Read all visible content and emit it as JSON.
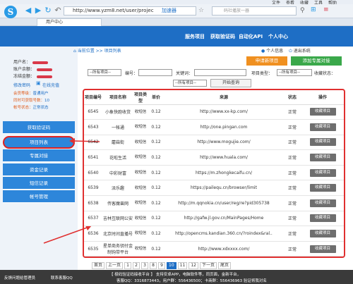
{
  "browser": {
    "menu": [
      "文件",
      "查看",
      "收藏",
      "工具",
      "帮助"
    ],
    "url": "http://www.yzm8.net/user/projec",
    "accel_label": "加速器",
    "search_placeholder": "码社播放一器",
    "tab_title": "用户中心"
  },
  "site": {
    "topnav": [
      "服务项目",
      "获取验证码",
      "自动化API",
      "个人中心"
    ]
  },
  "sidebar": {
    "user_labels": [
      "用户名：",
      "账户余额：",
      "冻结金额："
    ],
    "modify_password": "修改密码",
    "online_recharge": "在线充值",
    "member_level_label": "会员等级：",
    "member_level": "普通用户",
    "concurrent_label": "同时可获取号数：",
    "concurrent": "10",
    "account_status_label": "帐号状态：",
    "account_status": "正常状态",
    "menu": [
      "获取验证码",
      "项目列表",
      "专属对接",
      "资金记录",
      "短信记录",
      "帐号管理"
    ]
  },
  "content": {
    "breadcrumb": "当前位置 >> 项目列表",
    "user_links": [
      "个人信息",
      "退出系统"
    ],
    "apply_new_button": "申请新项目",
    "add_exclusive_button": "添加专属对接",
    "filters": {
      "all_projects_1": "--所有项目--",
      "code_label": "编号：",
      "keyword_label": "关键词：",
      "project_type_label": "项目类型：",
      "all_projects_2": "--所有项目--",
      "fav_status_label": "收藏状态：",
      "all_projects_3": "--所有项目--",
      "query_button": "开始查询"
    }
  },
  "table": {
    "headers": [
      "项目编号",
      "项目名称",
      "项目类型",
      "单价",
      "来源",
      "状态",
      "操作"
    ],
    "rows": [
      {
        "id": "6545",
        "name": "小象快跑收货",
        "type": "收短信",
        "price": "0.12",
        "source": "http://www.xx-kp.com/",
        "status": "正常",
        "action": "收藏项目"
      },
      {
        "id": "6543",
        "name": "一帐通",
        "type": "收短信",
        "price": "0.12",
        "source": "http://one.pingan.com",
        "status": "正常",
        "action": "收藏项目"
      },
      {
        "id": "6542",
        "name": "蘑菇街",
        "type": "收短信",
        "price": "0.12",
        "source": "http://www.mogujie.com/",
        "status": "正常",
        "action": "收藏项目"
      },
      {
        "id": "6541",
        "name": "花啦生活",
        "type": "收短信",
        "price": "0.12",
        "source": "http://www.huala.com/",
        "status": "正常",
        "action": "收藏项目"
      },
      {
        "id": "6540",
        "name": "中彩财富",
        "type": "收短信",
        "price": "0.12",
        "source": "https://m.zhongkecaifu.cn/",
        "status": "正常",
        "action": "收藏项目"
      },
      {
        "id": "6539",
        "name": "派乐趣",
        "type": "收短信",
        "price": "0.12",
        "source": "https://pailequ.cn/browser/limit",
        "status": "正常",
        "action": "收藏项目"
      },
      {
        "id": "6538",
        "name": "传客魔兽网",
        "type": "收短信",
        "price": "0.12",
        "source": "http://m.qqnokia.cn/user/reg/re?pid305738",
        "status": "正常",
        "action": "收藏项目"
      },
      {
        "id": "6537",
        "name": "吉林互联网公安",
        "type": "收短信",
        "price": "0.12",
        "source": "http://gafw.jl.gov.cn/MainPages/Home",
        "status": "正常",
        "action": "收藏项目"
      },
      {
        "id": "6536",
        "name": "北京时间直播号",
        "type": "收短信",
        "price": "0.12",
        "source": "http://opencms.kandian.360.cn/?roindex&ral..",
        "status": "正常",
        "action": "收藏项目"
      },
      {
        "id": "6535",
        "name": "星单商务钥付金制钩带平台",
        "type": "收短信",
        "price": "0.12",
        "source": "http://www.xdxxxx.com/",
        "status": "正常",
        "action": "收藏项目"
      }
    ]
  },
  "pager": {
    "first": "首页",
    "prev": "上一页",
    "pages": [
      "1",
      "2",
      "3",
      "8",
      "9",
      "10",
      "11",
      "12"
    ],
    "current": "10",
    "next": "下一页",
    "last": "尾页"
  },
  "footer": {
    "feedback": "反馈问题给管理员",
    "support": "联系客服QQ",
    "line1": "【 极码验证码接收平台 】 支持安卓APP，电脑软件等，同页面，金新平台，",
    "line2": "客服QQ：3316873443，用户群：556436500；卡商群：556436963 验证将我对名"
  },
  "colors": {
    "brand_blue": "#1e6ec5",
    "menu_blue": "#2d86da",
    "orange": "#f09020",
    "green": "#3aa84a",
    "highlight_red": "#e03030"
  }
}
